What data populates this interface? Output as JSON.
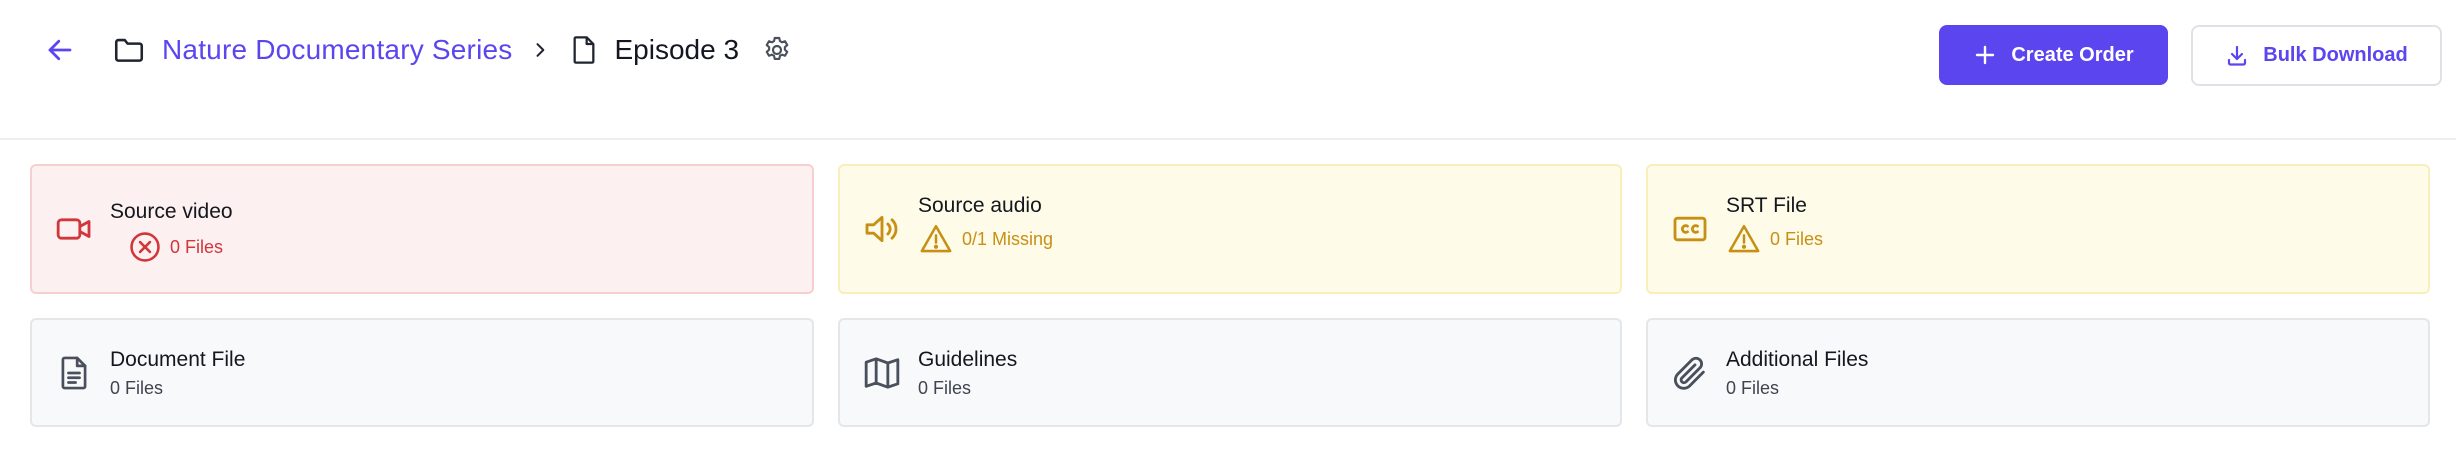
{
  "header": {
    "breadcrumb": {
      "folder": "Nature Documentary Series",
      "current": "Episode 3"
    },
    "actions": {
      "create_order": "Create Order",
      "bulk_download": "Bulk Download"
    }
  },
  "colors": {
    "accent": "#5b45ee",
    "error": "#d1363a",
    "warning": "#c79015",
    "error_bg": "#fdf0f0",
    "warning_bg": "#fefbe8",
    "neutral_bg": "#f8f9fb"
  },
  "cards": [
    {
      "title": "Source video",
      "status": "0 Files",
      "state": "error",
      "icon": "video-camera-icon"
    },
    {
      "title": "Source audio",
      "status": "0/1 Missing",
      "state": "warning",
      "icon": "speaker-icon"
    },
    {
      "title": "SRT File",
      "status": "0 Files",
      "state": "warning",
      "icon": "closed-captions-icon"
    },
    {
      "title": "Document File",
      "status": "0 Files",
      "state": "neutral",
      "icon": "document-icon"
    },
    {
      "title": "Guidelines",
      "status": "0 Files",
      "state": "neutral",
      "icon": "map-icon"
    },
    {
      "title": "Additional Files",
      "status": "0 Files",
      "state": "neutral",
      "icon": "paperclip-icon"
    }
  ]
}
